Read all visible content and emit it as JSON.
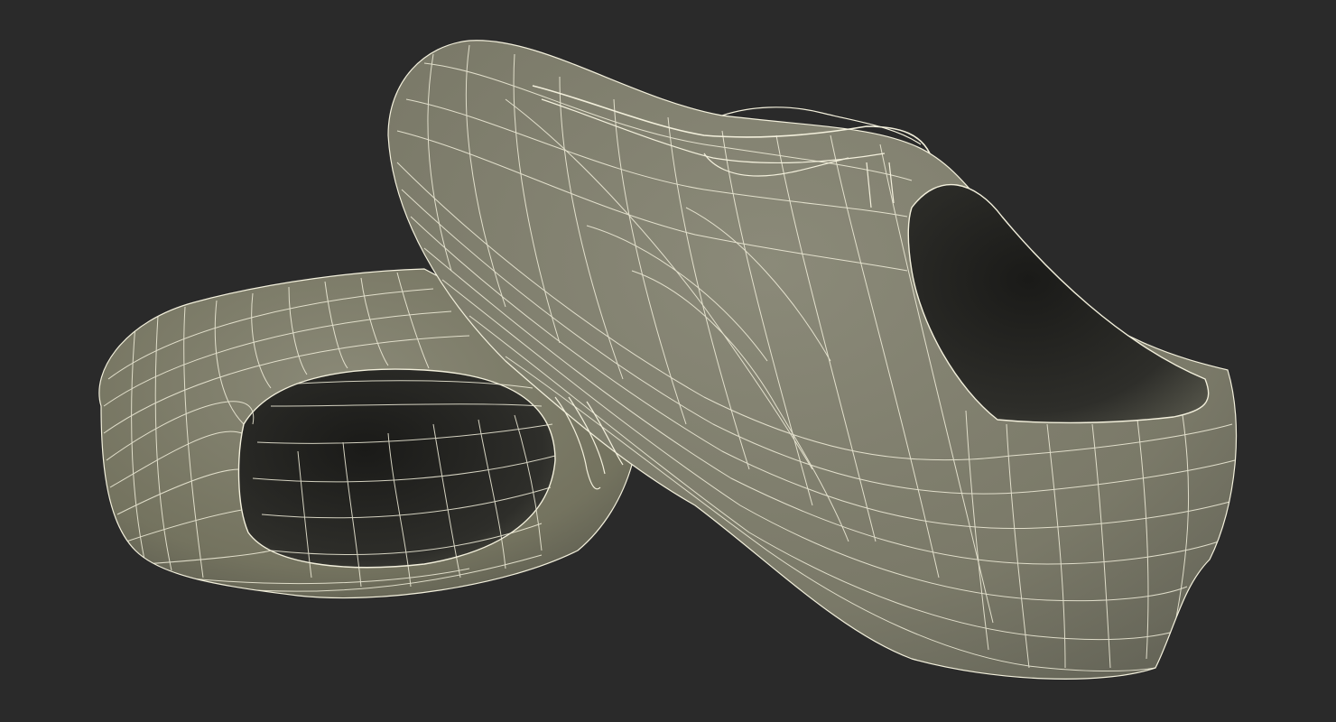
{
  "scene": {
    "subject": "wooden-clogs-wireframe",
    "background_color": "#2a2a2a",
    "surface_color": "#7c7b6d",
    "surface_shadow_color": "#5e5e53",
    "interior_color": "#1f1f1d",
    "wire_color": "#f3f0dc"
  }
}
